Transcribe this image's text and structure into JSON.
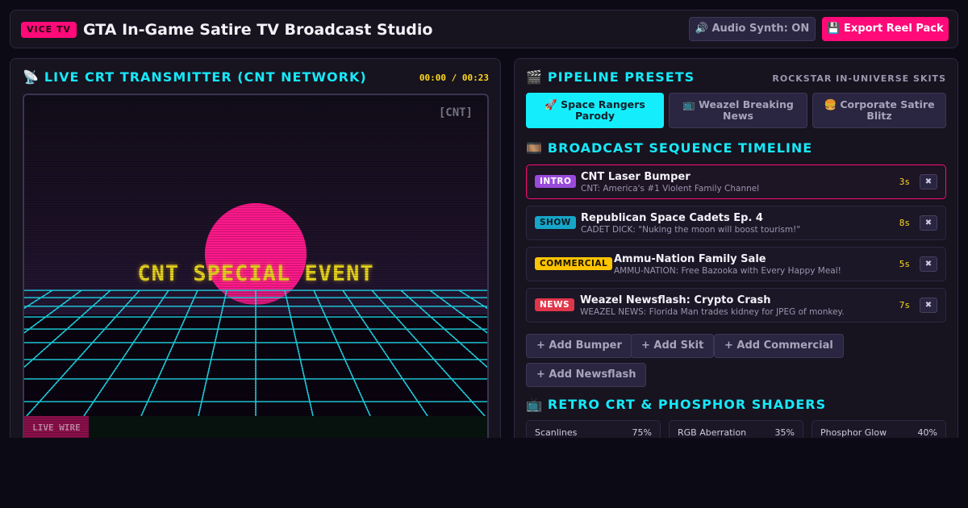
{
  "header": {
    "brand": "VICE TV",
    "title": "GTA In-Game Satire TV Broadcast Studio",
    "audio_button": "🔊 Audio Synth: ON",
    "export_button": "💾 Export Reel Pack"
  },
  "transmitter": {
    "icon": "📡",
    "icon_name": "satellite-antenna-icon",
    "title": "LIVE CRT TRANSMITTER (CNT NETWORK)",
    "timecode": "00:00 / 00:23",
    "watermark": "[CNT]",
    "event_text": "CNT SPECIAL EVENT",
    "live_label": "LIVE WIRE",
    "colors": {
      "sun": "#ff1a8c",
      "grid": "#1fd8e8",
      "text": "#e8d41e"
    }
  },
  "presets": {
    "icon": "🎬",
    "icon_name": "clapper-board-icon",
    "title": "PIPELINE PRESETS",
    "subtitle": "ROCKSTAR IN-UNIVERSE SKITS",
    "items": [
      {
        "label": "🚀 Space Rangers Parody",
        "active": true
      },
      {
        "label": "📺 Weazel Breaking News",
        "active": false
      },
      {
        "label": "🍔 Corporate Satire Blitz",
        "active": false
      }
    ]
  },
  "timeline": {
    "icon": "🎞️",
    "icon_name": "film-frames-icon",
    "title": "BROADCAST SEQUENCE TIMELINE",
    "delete_label": "✖",
    "rows": [
      {
        "tag": "INTRO",
        "title": "CNT Laser Bumper",
        "subtitle": "CNT: America's #1 Violent Family Channel",
        "duration": "3s",
        "selected": true
      },
      {
        "tag": "SHOW",
        "title": "Republican Space Cadets Ep. 4",
        "subtitle": "CADET DICK: \"Nuking the moon will boost tourism!\"",
        "duration": "8s",
        "selected": false
      },
      {
        "tag": "COMMERCIAL",
        "title": "Ammu-Nation Family Sale",
        "subtitle": "AMMU-NATION: Free Bazooka with Every Happy Meal!",
        "duration": "5s",
        "selected": false
      },
      {
        "tag": "NEWS",
        "title": "Weazel Newsflash: Crypto Crash",
        "subtitle": "WEAZEL NEWS: Florida Man trades kidney for JPEG of monkey.",
        "duration": "7s",
        "selected": false
      }
    ],
    "add_buttons": [
      "+ Add Bumper",
      "+ Add Skit",
      "+ Add Commercial",
      "+ Add Newsflash"
    ]
  },
  "shaders": {
    "icon": "📺",
    "icon_name": "television-icon",
    "title": "RETRO CRT & PHOSPHOR SHADERS",
    "items": [
      {
        "name": "Scanlines",
        "value": "75%"
      },
      {
        "name": "RGB Aberration",
        "value": "35%"
      },
      {
        "name": "Phosphor Glow",
        "value": "40%"
      }
    ]
  }
}
